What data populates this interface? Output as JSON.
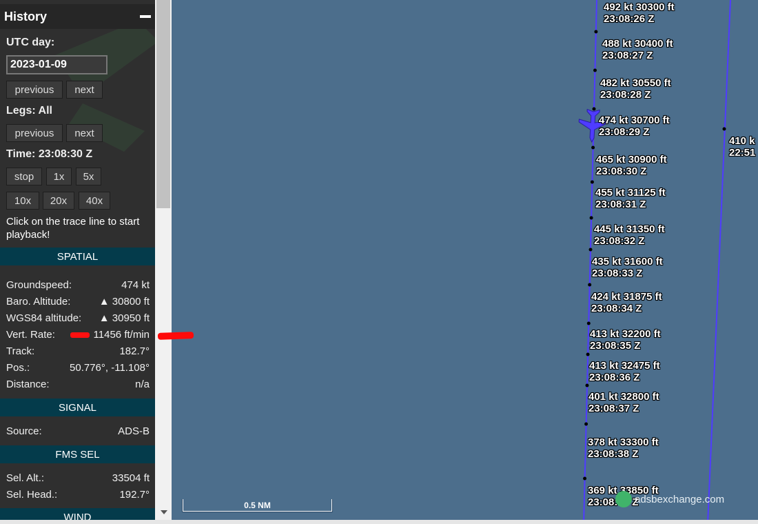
{
  "history": {
    "title": "History",
    "utc_day_label": "UTC day:",
    "date_value": "2023-01-09",
    "prev_label": "previous",
    "next_label": "next",
    "legs_label": "Legs: All",
    "legs_prev_label": "previous",
    "legs_next_label": "next",
    "time_label": "Time: 23:08:30 Z",
    "speed_buttons": [
      "stop",
      "1x",
      "5x",
      "10x",
      "20x",
      "40x"
    ],
    "hint": "Click on the trace line to start playback!"
  },
  "spatial": {
    "header": "SPATIAL",
    "rows": [
      {
        "label": "Groundspeed:",
        "value": "474 kt"
      },
      {
        "label": "Baro. Altitude:",
        "value": "▲ 30800 ft"
      },
      {
        "label": "WGS84 altitude:",
        "value": "▲ 30950 ft"
      },
      {
        "label": "Vert. Rate:",
        "value": "11456 ft/min"
      },
      {
        "label": "Track:",
        "value": "182.7°"
      },
      {
        "label": "Pos.:",
        "value": "50.776°, -11.108°"
      },
      {
        "label": "Distance:",
        "value": "n/a"
      }
    ]
  },
  "signal": {
    "header": "SIGNAL",
    "rows": [
      {
        "label": "Source:",
        "value": "ADS-B"
      }
    ]
  },
  "fms": {
    "header": "FMS SEL",
    "rows": [
      {
        "label": "Sel. Alt.:",
        "value": "33504 ft"
      },
      {
        "label": "Sel. Head.:",
        "value": "192.7°"
      }
    ]
  },
  "wind": {
    "header": "WIND"
  },
  "map": {
    "track_labels": [
      {
        "speed": "492 kt",
        "alt": "30300 ft",
        "time": "23:08:26 Z"
      },
      {
        "speed": "488 kt",
        "alt": "30400 ft",
        "time": "23:08:27 Z"
      },
      {
        "speed": "482 kt",
        "alt": "30550 ft",
        "time": "23:08:28 Z"
      },
      {
        "speed": "474 kt",
        "alt": "30700 ft",
        "time": "23:08:29 Z"
      },
      {
        "speed": "465 kt",
        "alt": "30900 ft",
        "time": "23:08:30 Z"
      },
      {
        "speed": "455 kt",
        "alt": "31125 ft",
        "time": "23:08:31 Z"
      },
      {
        "speed": "445 kt",
        "alt": "31350 ft",
        "time": "23:08:32 Z"
      },
      {
        "speed": "435 kt",
        "alt": "31600 ft",
        "time": "23:08:33 Z"
      },
      {
        "speed": "424 kt",
        "alt": "31875 ft",
        "time": "23:08:34 Z"
      },
      {
        "speed": "413 kt",
        "alt": "32200 ft",
        "time": "23:08:35 Z"
      },
      {
        "speed": "413 kt",
        "alt": "32475 ft",
        "time": "23:08:36 Z"
      },
      {
        "speed": "401 kt",
        "alt": "32800 ft",
        "time": "23:08:37 Z"
      },
      {
        "speed": "378 kt",
        "alt": "33300 ft",
        "time": "23:08:38 Z"
      },
      {
        "speed": "369 kt",
        "alt": "33850 ft",
        "time": "23:08:40 Z"
      }
    ],
    "other_track_label": {
      "speed": "410 k",
      "time": "22:51"
    },
    "scale": "0.5 NM",
    "watermark": "adsbexchange.com",
    "colors": {
      "track": "#4f3cff",
      "aircraft": "#4f3cff",
      "water": "#4c6e8c",
      "highlight": "#ff0a0a"
    }
  }
}
